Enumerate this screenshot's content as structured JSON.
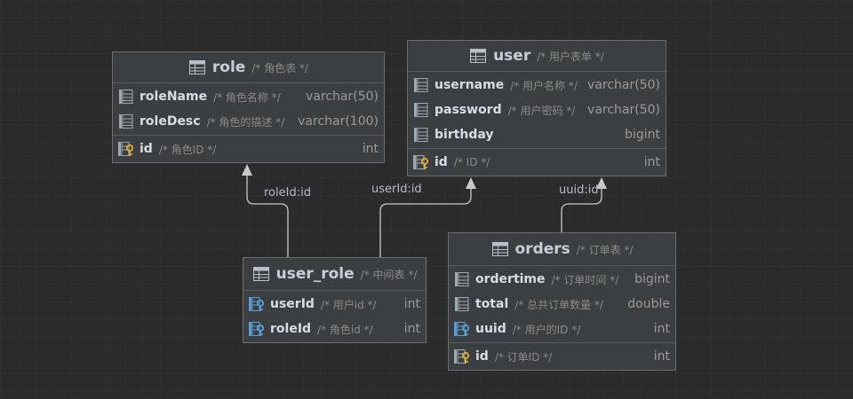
{
  "tables": {
    "role": {
      "name": "role",
      "comment": "/* 角色表 */",
      "columns": [
        {
          "name": "roleName",
          "comment": "/* 角色名称 */",
          "type": "varchar(50)",
          "kind": "column"
        },
        {
          "name": "roleDesc",
          "comment": "/* 角色的描述 */",
          "type": "varchar(100)",
          "kind": "column"
        }
      ],
      "keys": [
        {
          "name": "id",
          "comment": "/* 角色ID */",
          "type": "int",
          "kind": "primary-key"
        }
      ]
    },
    "user": {
      "name": "user",
      "comment": "/* 用户表单 */",
      "columns": [
        {
          "name": "username",
          "comment": "/* 用户名称 */",
          "type": "varchar(50)",
          "kind": "column"
        },
        {
          "name": "password",
          "comment": "/* 用户密码 */",
          "type": "varchar(50)",
          "kind": "column"
        },
        {
          "name": "birthday",
          "comment": "",
          "type": "bigint",
          "kind": "column"
        }
      ],
      "keys": [
        {
          "name": "id",
          "comment": "/* ID */",
          "type": "int",
          "kind": "primary-key"
        }
      ]
    },
    "user_role": {
      "name": "user_role",
      "comment": "/* 中间表 */",
      "columns": [
        {
          "name": "userId",
          "comment": "/* 用户id */",
          "type": "int",
          "kind": "foreign-key"
        },
        {
          "name": "roleId",
          "comment": "/* 角色id */",
          "type": "int",
          "kind": "foreign-key"
        }
      ],
      "keys": []
    },
    "orders": {
      "name": "orders",
      "comment": "/* 订单表 */",
      "columns": [
        {
          "name": "ordertime",
          "comment": "/* 订单时间 */",
          "type": "bigint",
          "kind": "column"
        },
        {
          "name": "total",
          "comment": "/* 总共订单数量 */",
          "type": "double",
          "kind": "column"
        },
        {
          "name": "uuid",
          "comment": "/* 用户的ID */",
          "type": "int",
          "kind": "foreign-key"
        }
      ],
      "keys": [
        {
          "name": "id",
          "comment": "/* 订单ID */",
          "type": "int",
          "kind": "primary-key"
        }
      ]
    }
  },
  "relations": [
    {
      "label": "roleId:id",
      "from": "user_role",
      "to": "role"
    },
    {
      "label": "userId:id",
      "from": "user_role",
      "to": "user"
    },
    {
      "label": "uuid:id",
      "from": "orders",
      "to": "user"
    }
  ],
  "colors": {
    "background": "#2b2b2b",
    "table_bg": "#3c3f41",
    "border": "#6e6e6e",
    "connector": "#c8c8c8",
    "key_gold": "#e0b030",
    "key_blue": "#5aa0d8",
    "column_icon": "#a0a8b0"
  }
}
